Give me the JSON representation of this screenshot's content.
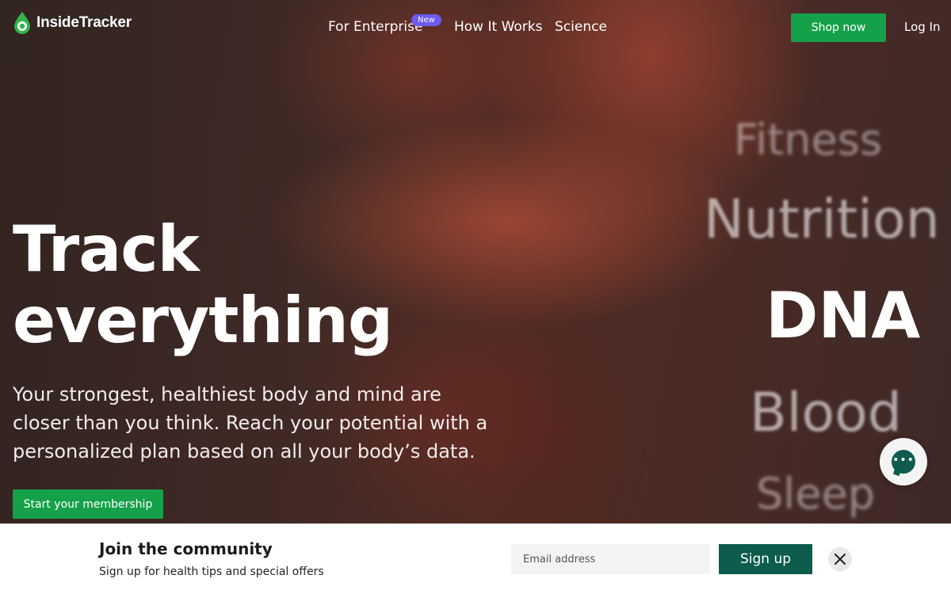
{
  "brand": {
    "name": "InsideTracker",
    "accent": "#15a14a",
    "dark_green": "#0d5c4d",
    "badge_color": "#6b5cf0"
  },
  "nav": {
    "links": [
      {
        "label": "For Enterprise",
        "badge": "New"
      },
      {
        "label": "How It Works"
      },
      {
        "label": "Science"
      }
    ],
    "shop_label": "Shop now",
    "login_label": "Log In"
  },
  "hero": {
    "headline_line1": "Track",
    "headline_line2": "everything",
    "subtext": "Your strongest, healthiest body and mind are closer than you think. Reach your potential with a personalized plan based on all your body’s data.",
    "cta_label": "Start your membership",
    "rotating_words": [
      "Fitness",
      "Nutrition",
      "DNA",
      "Blood",
      "Sleep"
    ]
  },
  "chat": {
    "icon": "chat-bubble-icon"
  },
  "newsletter": {
    "title": "Join the community",
    "subtitle": "Sign up for health tips and special offers",
    "email_placeholder": "Email address",
    "signup_label": "Sign up",
    "close_icon": "close-icon"
  }
}
